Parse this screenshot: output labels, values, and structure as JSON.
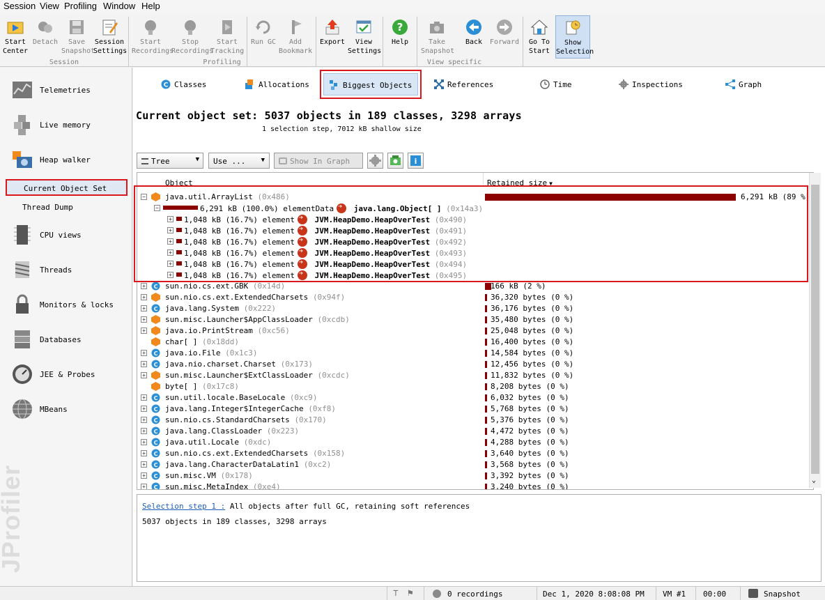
{
  "menubar": {
    "items": [
      "Session",
      "View",
      "Profiling",
      "Window",
      "Help"
    ]
  },
  "toolbar": {
    "buttons": [
      {
        "label": "Start\nCenter",
        "icon": "start-center-icon"
      },
      {
        "label": "Detach",
        "icon": "detach-icon"
      },
      {
        "label": "Save\nSnapshot",
        "icon": "save-snapshot-icon"
      },
      {
        "label": "Session\nSettings",
        "icon": "session-settings-icon"
      },
      {
        "label": "Start\nRecordings",
        "icon": "start-recordings-icon"
      },
      {
        "label": "Stop\nRecordings",
        "icon": "stop-recordings-icon"
      },
      {
        "label": "Start\nTracking",
        "icon": "start-tracking-icon"
      },
      {
        "label": "Run GC",
        "icon": "run-gc-icon"
      },
      {
        "label": "Add\nBookmark",
        "icon": "add-bookmark-icon"
      },
      {
        "label": "Export",
        "icon": "export-icon"
      },
      {
        "label": "View\nSettings",
        "icon": "view-settings-icon"
      },
      {
        "label": "Help",
        "icon": "help-icon"
      },
      {
        "label": "Take\nSnapshot",
        "icon": "take-snapshot-icon"
      },
      {
        "label": "Back",
        "icon": "back-icon"
      },
      {
        "label": "Forward",
        "icon": "forward-icon"
      },
      {
        "label": "Go To\nStart",
        "icon": "go-to-start-icon"
      },
      {
        "label": "Show\nSelection",
        "icon": "show-selection-icon"
      }
    ],
    "groups": [
      "Session",
      "Profiling",
      "View specific"
    ]
  },
  "sidebar": {
    "items": [
      {
        "label": "Telemetries",
        "icon": "telemetries-icon"
      },
      {
        "label": "Live memory",
        "icon": "live-memory-icon"
      },
      {
        "label": "Heap walker",
        "icon": "heap-walker-icon"
      },
      {
        "label": "CPU views",
        "icon": "cpu-views-icon"
      },
      {
        "label": "Threads",
        "icon": "threads-icon"
      },
      {
        "label": "Monitors & locks",
        "icon": "monitors-locks-icon"
      },
      {
        "label": "Databases",
        "icon": "databases-icon"
      },
      {
        "label": "JEE & Probes",
        "icon": "jee-probes-icon"
      },
      {
        "label": "MBeans",
        "icon": "mbeans-icon"
      }
    ],
    "sub_items": [
      "Current Object Set",
      "Thread Dump"
    ],
    "watermark": "JProfiler"
  },
  "tabs": [
    {
      "label": "Classes",
      "icon": "classes-tab-icon"
    },
    {
      "label": "Allocations",
      "icon": "allocations-tab-icon"
    },
    {
      "label": "Biggest Objects",
      "icon": "biggest-objects-tab-icon"
    },
    {
      "label": "References",
      "icon": "references-tab-icon"
    },
    {
      "label": "Time",
      "icon": "time-tab-icon"
    },
    {
      "label": "Inspections",
      "icon": "inspections-tab-icon"
    },
    {
      "label": "Graph",
      "icon": "graph-tab-icon"
    }
  ],
  "header": {
    "title": "Current object set: 5037 objects in 189 classes, 3298 arrays",
    "subtitle": "1 selection step, 7012 kB shallow size"
  },
  "viewbar": {
    "view_mode": "Tree",
    "use_label": "Use ...",
    "show_in_graph": "Show In Graph"
  },
  "table": {
    "col_object": "Object",
    "col_retained": "Retained size",
    "root": {
      "name": "java.util.ArrayList",
      "id": "(0x486)",
      "retained": "6,291 kB (89 %)",
      "fraction": 0.89
    },
    "element_data": {
      "size": "6,291 kB (100.0%)",
      "field": "elementData",
      "target": "java.lang.Object[ ]",
      "id": "(0x14a3)"
    },
    "elements": [
      {
        "size": "1,048 kB (16.7%)",
        "field": "element",
        "target": "JVM.HeapDemo.HeapOverTest",
        "id": "(0x490)"
      },
      {
        "size": "1,048 kB (16.7%)",
        "field": "element",
        "target": "JVM.HeapDemo.HeapOverTest",
        "id": "(0x491)"
      },
      {
        "size": "1,048 kB (16.7%)",
        "field": "element",
        "target": "JVM.HeapDemo.HeapOverTest",
        "id": "(0x492)"
      },
      {
        "size": "1,048 kB (16.7%)",
        "field": "element",
        "target": "JVM.HeapDemo.HeapOverTest",
        "id": "(0x493)"
      },
      {
        "size": "1,048 kB (16.7%)",
        "field": "element",
        "target": "JVM.HeapDemo.HeapOverTest",
        "id": "(0x494)"
      },
      {
        "size": "1,048 kB (16.7%)",
        "field": "element",
        "target": "JVM.HeapDemo.HeapOverTest",
        "id": "(0x495)"
      }
    ],
    "rows": [
      {
        "name": "sun.nio.cs.ext.GBK",
        "id": "(0x14d)",
        "retained": "166 kB (2 %)",
        "icon": "class",
        "expand": true
      },
      {
        "name": "sun.nio.cs.ext.ExtendedCharsets",
        "id": "(0x94f)",
        "retained": "36,320 bytes (0 %)",
        "icon": "object",
        "expand": true
      },
      {
        "name": "java.lang.System",
        "id": "(0x222)",
        "retained": "36,176 bytes (0 %)",
        "icon": "class",
        "expand": true
      },
      {
        "name": "sun.misc.Launcher$AppClassLoader",
        "id": "(0xcdb)",
        "retained": "35,480 bytes (0 %)",
        "icon": "object",
        "expand": true
      },
      {
        "name": "java.io.PrintStream",
        "id": "(0xc56)",
        "retained": "25,048 bytes (0 %)",
        "icon": "object",
        "expand": true
      },
      {
        "name": "char[ ]",
        "id": "(0x18dd)",
        "retained": "16,400 bytes (0 %)",
        "icon": "object",
        "expand": false
      },
      {
        "name": "java.io.File",
        "id": "(0x1c3)",
        "retained": "14,584 bytes (0 %)",
        "icon": "class",
        "expand": true
      },
      {
        "name": "java.nio.charset.Charset",
        "id": "(0x173)",
        "retained": "12,456 bytes (0 %)",
        "icon": "class",
        "expand": true
      },
      {
        "name": "sun.misc.Launcher$ExtClassLoader",
        "id": "(0xcdc)",
        "retained": "11,832 bytes (0 %)",
        "icon": "object",
        "expand": true
      },
      {
        "name": "byte[ ]",
        "id": "(0x17c8)",
        "retained": "8,208 bytes (0 %)",
        "icon": "object",
        "expand": false
      },
      {
        "name": "sun.util.locale.BaseLocale",
        "id": "(0xc9)",
        "retained": "6,032 bytes (0 %)",
        "icon": "class",
        "expand": true
      },
      {
        "name": "java.lang.Integer$IntegerCache",
        "id": "(0xf8)",
        "retained": "5,768 bytes (0 %)",
        "icon": "class",
        "expand": true
      },
      {
        "name": "sun.nio.cs.StandardCharsets",
        "id": "(0x170)",
        "retained": "5,376 bytes (0 %)",
        "icon": "class",
        "expand": true
      },
      {
        "name": "java.lang.ClassLoader",
        "id": "(0x223)",
        "retained": "4,472 bytes (0 %)",
        "icon": "class",
        "expand": true
      },
      {
        "name": "java.util.Locale",
        "id": "(0xdc)",
        "retained": "4,288 bytes (0 %)",
        "icon": "class",
        "expand": true
      },
      {
        "name": "sun.nio.cs.ext.ExtendedCharsets",
        "id": "(0x158)",
        "retained": "3,640 bytes (0 %)",
        "icon": "class",
        "expand": true
      },
      {
        "name": "java.lang.CharacterDataLatin1",
        "id": "(0xc2)",
        "retained": "3,568 bytes (0 %)",
        "icon": "class",
        "expand": true
      },
      {
        "name": "sun.misc.VM",
        "id": "(0x178)",
        "retained": "3,392 bytes (0 %)",
        "icon": "class",
        "expand": true
      },
      {
        "name": "sun.misc.MetaIndex",
        "id": "(0xe4)",
        "retained": "3,240 bytes (0 %)",
        "icon": "class",
        "expand": true
      }
    ]
  },
  "details": {
    "step_link": "Selection step 1 :",
    "step_text": "All objects after full GC, retaining soft references",
    "summary": "5037 objects in 189 classes, 3298 arrays"
  },
  "status": {
    "recordings": "0 recordings",
    "datetime": "Dec 1, 2020 8:08:08 PM",
    "vm": "VM #1",
    "elapsed": "00:00",
    "mode": "Snapshot"
  },
  "colors": {
    "bar": "#8b0000",
    "highlight": "#d9171d",
    "selected": "#dfe8f3",
    "orange": "#f08a1c",
    "blue": "#2b8fd6"
  }
}
